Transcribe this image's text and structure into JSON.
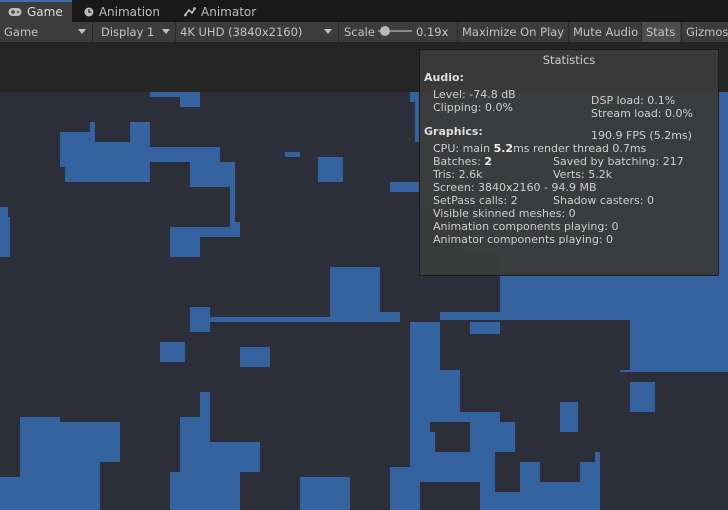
{
  "tabs": [
    {
      "label": "Game",
      "icon": "gamepad-icon",
      "active": true
    },
    {
      "label": "Animation",
      "icon": "clock-icon",
      "active": false
    },
    {
      "label": "Animator",
      "icon": "animator-icon",
      "active": false
    }
  ],
  "toolbar": {
    "mode_select": "Game",
    "display_select": "Display 1",
    "resolution_select": "4K UHD (3840x2160)",
    "scale_label": "Scale",
    "scale_value": "0.19x",
    "scale_level": 0.19,
    "maximize_label": "Maximize On Play",
    "mute_label": "Mute Audio",
    "stats_label": "Stats",
    "gizmos_label": "Gizmos"
  },
  "stats": {
    "title": "Statistics",
    "audio_header": "Audio:",
    "level": "Level: -74.8 dB",
    "clipping": "Clipping: 0.0%",
    "dsp_load": "DSP load: 0.1%",
    "stream_load": "Stream load: 0.0%",
    "graphics_header": "Graphics:",
    "fps": "190.9 FPS (5.2ms)",
    "cpu_prefix": "CPU: main ",
    "cpu_main": "5.2",
    "cpu_suffix": "ms  render thread 0.7ms",
    "batches_prefix": "Batches: ",
    "batches": "2",
    "saved_batching": "Saved by batching: 217",
    "tris": "Tris: 2.6k",
    "verts": "Verts: 5.2k",
    "screen": "Screen: 3840x2160 - 94.9 MB",
    "setpass": "SetPass calls: 2",
    "shadow_casters": "Shadow casters: 0",
    "skinned_meshes": "Visible skinned meshes: 0",
    "animation_components": "Animation components playing: 0",
    "animator_components": "Animator components playing: 0"
  },
  "colors": {
    "accent": "#3a72b0",
    "scene_blue": "#3563a0",
    "scene_dark": "#2c2f3a"
  }
}
